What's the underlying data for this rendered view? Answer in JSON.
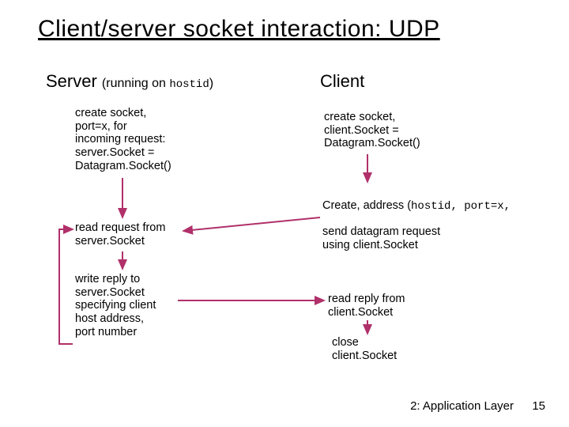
{
  "title": "Client/server socket interaction: UDP",
  "server": {
    "heading_prefix": "Server ",
    "heading_sub_open": "(running on ",
    "heading_hostid": "hostid",
    "heading_sub_close": ")",
    "step1": "create socket,\nport=x, for\nincoming request:\nserver.Socket =\nDatagram.Socket()",
    "step2": "read request from\nserver.Socket",
    "step3": "write reply to\nserver.Socket\nspecifying client\nhost address,\nport number"
  },
  "client": {
    "heading": "Client",
    "step1": "create socket,\nclient.Socket =\nDatagram.Socket()",
    "step2_prefix": "Create, address (",
    "step2_code": "hostid, port=x,",
    "step2_rest": "send datagram request\nusing client.Socket",
    "step3": "read reply from\nclient.Socket",
    "step4": "close\nclient.Socket"
  },
  "footer": "2: Application Layer",
  "page": "15",
  "colors": {
    "arrow": "#b0306a"
  }
}
